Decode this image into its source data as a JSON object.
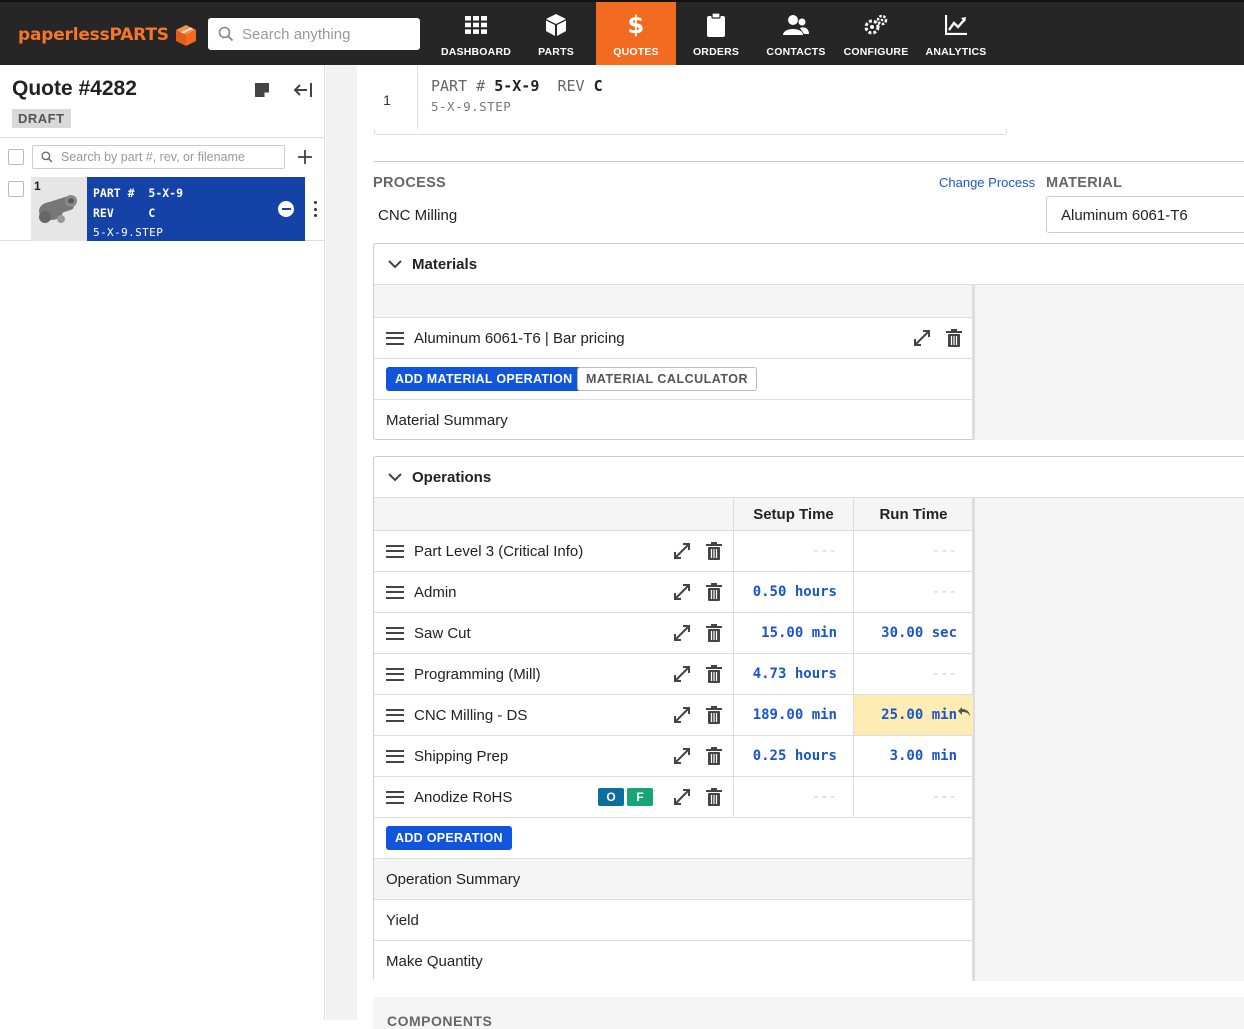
{
  "brand": {
    "name_part1": "paperless",
    "name_part2": "PARTS",
    "color": "#f26b21"
  },
  "search": {
    "placeholder": "Search anything"
  },
  "nav": [
    {
      "label": "DASHBOARD",
      "icon": "grid-icon",
      "active": false
    },
    {
      "label": "PARTS",
      "icon": "cube-icon",
      "active": false
    },
    {
      "label": "QUOTES",
      "icon": "dollar-icon",
      "active": true
    },
    {
      "label": "ORDERS",
      "icon": "clipboard-icon",
      "active": false
    },
    {
      "label": "CONTACTS",
      "icon": "people-icon",
      "active": false
    },
    {
      "label": "CONFIGURE",
      "icon": "gears-icon",
      "active": false
    },
    {
      "label": "ANALYTICS",
      "icon": "chart-icon",
      "active": false
    }
  ],
  "sidebar": {
    "quote_title": "Quote #4282",
    "status": "DRAFT",
    "search_placeholder": "Search by part #, rev, or filename",
    "parts": [
      {
        "index": "1",
        "part_label": "PART #",
        "part_value": "5-X-9",
        "rev_label": "REV",
        "rev_value": "C",
        "filename": "5-X-9.STEP"
      }
    ]
  },
  "header": {
    "index": "1",
    "part_label": "PART #",
    "part_value": "5-X-9",
    "rev_label": "REV",
    "rev_value": "C",
    "filename": "5-X-9.STEP"
  },
  "process": {
    "label": "PROCESS",
    "value": "CNC Milling",
    "change_link": "Change Process"
  },
  "material": {
    "label": "MATERIAL",
    "value": "Aluminum 6061-T6"
  },
  "materials_panel": {
    "title": "Materials",
    "rows": [
      {
        "label": "Aluminum 6061-T6 | Bar pricing"
      }
    ],
    "add_button": "ADD MATERIAL OPERATION",
    "calc_button": "MATERIAL CALCULATOR",
    "summary": "Material Summary"
  },
  "operations_panel": {
    "title": "Operations",
    "columns": [
      "Setup Time",
      "Run Time"
    ],
    "rows": [
      {
        "label": "Part Level 3 (Critical Info)",
        "setup": "---",
        "run": "---"
      },
      {
        "label": "Admin",
        "setup": "0.50 hours",
        "run": "---"
      },
      {
        "label": "Saw Cut",
        "setup": "15.00 min",
        "run": "30.00 sec"
      },
      {
        "label": "Programming (Mill)",
        "setup": "4.73 hours",
        "run": "---"
      },
      {
        "label": "CNC Milling - DS",
        "setup": "189.00 min",
        "run": "25.00 min"
      },
      {
        "label": "Shipping Prep",
        "setup": "0.25 hours",
        "run": "3.00 min"
      },
      {
        "label": "Anodize RoHS",
        "setup": "---",
        "run": "---",
        "tags": [
          "O",
          "F"
        ]
      }
    ],
    "add_button": "ADD OPERATION",
    "summaries": [
      "Operation Summary",
      "Yield",
      "Make Quantity"
    ]
  },
  "components": {
    "label": "COMPONENTS"
  },
  "colors": {
    "accent_blue": "#1155dd",
    "selected_part": "#1542a6",
    "highlight": "#fdedb5",
    "tag_o": "#0b6e9e",
    "tag_f": "#17a673"
  }
}
